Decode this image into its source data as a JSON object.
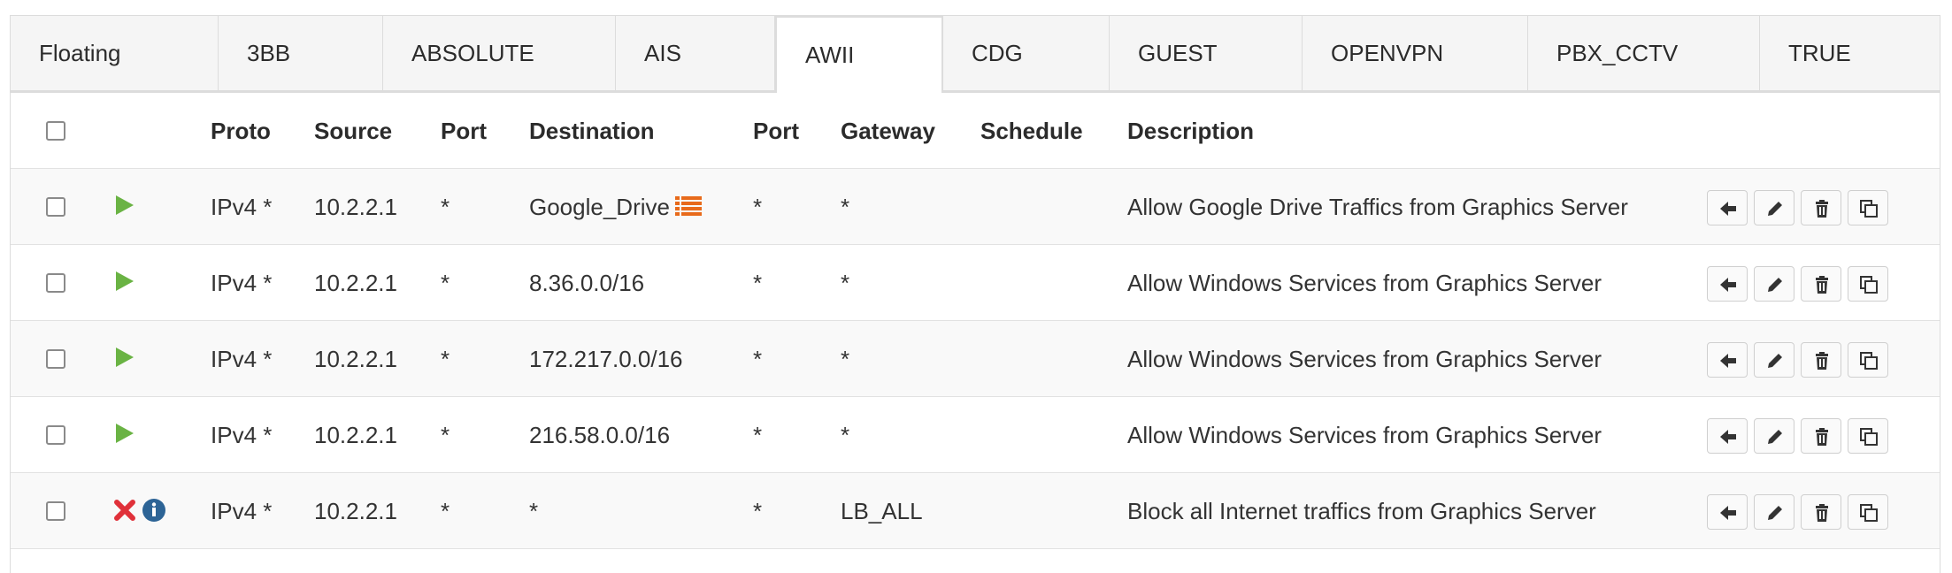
{
  "tabs": [
    "Floating",
    "3BB",
    "ABSOLUTE",
    "AIS",
    "AWII",
    "CDG",
    "GUEST",
    "OPENVPN",
    "PBX_CCTV",
    "TRUE"
  ],
  "active_tab": "AWII",
  "columns": {
    "proto": "Proto",
    "source": "Source",
    "port": "Port",
    "destination": "Destination",
    "dport": "Port",
    "gateway": "Gateway",
    "schedule": "Schedule",
    "description": "Description"
  },
  "rules": [
    {
      "action": "pass",
      "proto": "IPv4 *",
      "source": "10.2.2.1",
      "port": "*",
      "destination": "Google_Drive",
      "dport": "*",
      "gateway": "*",
      "schedule": "",
      "description": "Allow Google Drive Traffics from Graphics Server",
      "alias_icon": "list-icon"
    },
    {
      "action": "pass",
      "proto": "IPv4 *",
      "source": "10.2.2.1",
      "port": "*",
      "destination": "8.36.0.0/16",
      "dport": "*",
      "gateway": "*",
      "schedule": "",
      "description": "Allow Windows Services from Graphics Server"
    },
    {
      "action": "pass",
      "proto": "IPv4 *",
      "source": "10.2.2.1",
      "port": "*",
      "destination": "172.217.0.0/16",
      "dport": "*",
      "gateway": "*",
      "schedule": "",
      "description": "Allow Windows Services from Graphics Server"
    },
    {
      "action": "pass",
      "proto": "IPv4 *",
      "source": "10.2.2.1",
      "port": "*",
      "destination": "216.58.0.0/16",
      "dport": "*",
      "gateway": "*",
      "schedule": "",
      "description": "Allow Windows Services from Graphics Server"
    },
    {
      "action": "block",
      "proto": "IPv4 *",
      "source": "10.2.2.1",
      "port": "*",
      "destination": "*",
      "dport": "*",
      "gateway": "LB_ALL",
      "schedule": "",
      "description": "Block all Internet traffics from Graphics Server"
    }
  ],
  "row_actions": [
    "anchor-icon",
    "edit-icon",
    "delete-icon",
    "copy-icon"
  ],
  "colors": {
    "pass": "#6ab344",
    "block": "#e0313a",
    "info": "#2d6496",
    "alias": "#e86a1b"
  }
}
